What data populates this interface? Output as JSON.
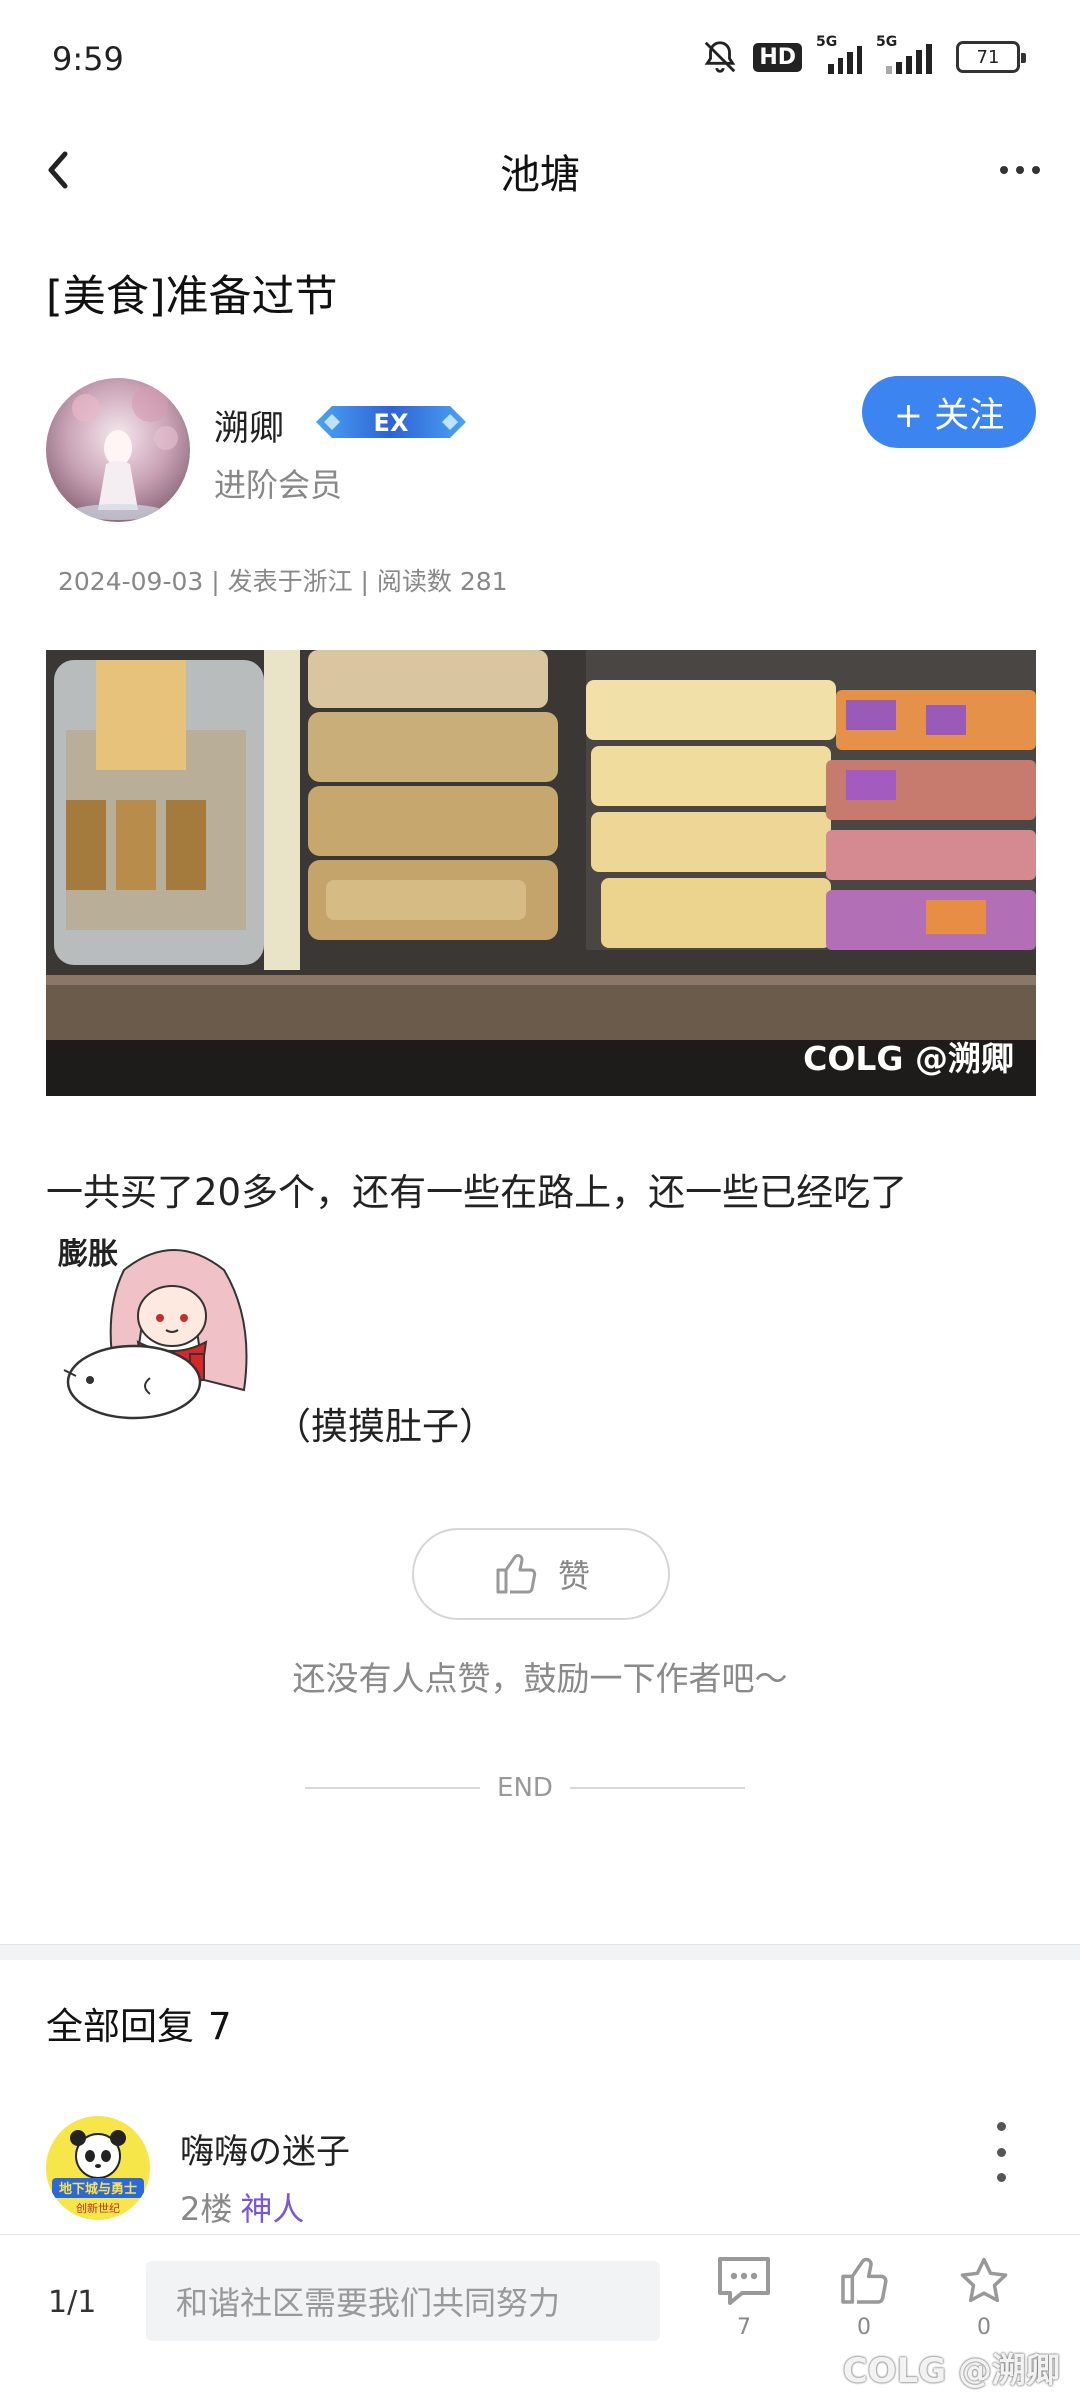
{
  "status_bar": {
    "time": "9:59",
    "hd_label": "HD",
    "network_1": "5G",
    "network_2": "5G",
    "battery": "71"
  },
  "nav": {
    "title": "池塘",
    "back_icon": "chevron-left-icon",
    "more_icon": "more-horizontal-icon"
  },
  "post": {
    "title": "[美食]准备过节",
    "author": {
      "name": "溯卿",
      "badge": "EX",
      "level": "进阶会员"
    },
    "follow_label": "+ 关注",
    "meta": "2024-09-03 | 发表于浙江 | 阅读数 281",
    "photo_watermark": "COLG @溯卿",
    "body": "一共买了20多个，还有一些在路上，还一些已经吃了",
    "sticker_text": "膨胀",
    "sticker_caption": "（摸摸肚子）",
    "like_label": "赞",
    "like_hint": "还没有人点赞，鼓励一下作者吧～",
    "end_label": "END"
  },
  "replies": {
    "title": "全部回复",
    "count": "7",
    "items": [
      {
        "name": "嗨嗨の迷子",
        "floor": "2楼",
        "rank": "神人",
        "avatar_text_1": "地下城与勇士",
        "avatar_text_2": "创新世纪"
      }
    ]
  },
  "bottom_bar": {
    "page": "1/1",
    "input_placeholder": "和谐社区需要我们共同努力",
    "comment_count": "7",
    "like_count": "0",
    "favorite_count": "0",
    "watermark": "COLG @溯卿"
  },
  "colors": {
    "accent": "#3c85f0",
    "rank": "#7b57d8"
  }
}
